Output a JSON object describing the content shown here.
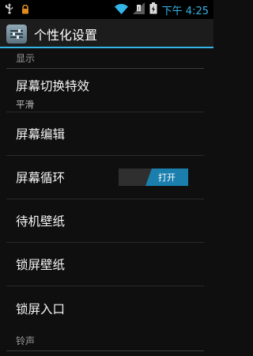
{
  "status_bar": {
    "time": "下午 4:25",
    "icons": [
      "usb-icon",
      "lock-icon",
      "wifi-icon",
      "signal-icon",
      "battery-icon"
    ]
  },
  "action_bar": {
    "title": "个性化设置",
    "icon": "settings-sliders-icon"
  },
  "colors": {
    "accent": "#33b5e5",
    "toggle_on": "#1b7fad",
    "background": "#0f0f0f"
  },
  "sections": [
    {
      "header": "显示",
      "items": [
        {
          "title": "屏幕切换特效",
          "subtitle": "平滑"
        },
        {
          "title": "屏幕编辑"
        },
        {
          "title": "屏幕循环",
          "toggle": "打开"
        },
        {
          "title": "待机壁纸"
        },
        {
          "title": "锁屏壁纸"
        },
        {
          "title": "锁屏入口"
        }
      ]
    },
    {
      "header": "铃声",
      "items": []
    }
  ]
}
